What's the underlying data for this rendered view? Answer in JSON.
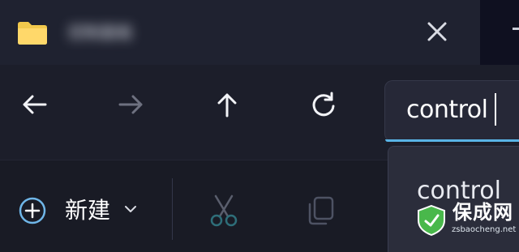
{
  "tab": {
    "title": "控制面板",
    "folder_icon": "folder-icon",
    "close_icon": "close-icon"
  },
  "navigation": {
    "back_icon": "arrow-left-icon",
    "forward_icon": "arrow-right-icon",
    "up_icon": "arrow-up-icon",
    "refresh_icon": "refresh-icon"
  },
  "search": {
    "value": "control"
  },
  "suggestion": {
    "label": "control"
  },
  "toolbar": {
    "new_label": "新建",
    "new_icon": "plus-circle-icon",
    "chevron_icon": "chevron-down-icon",
    "cut_icon": "scissors-icon",
    "copy_icon": "copy-icon"
  },
  "watermark": {
    "name": "保成网",
    "url": "zsbaocheng.net"
  },
  "colors": {
    "background": "#191b25",
    "accent": "#59b4e6",
    "watermark_green": "#49b84b"
  }
}
